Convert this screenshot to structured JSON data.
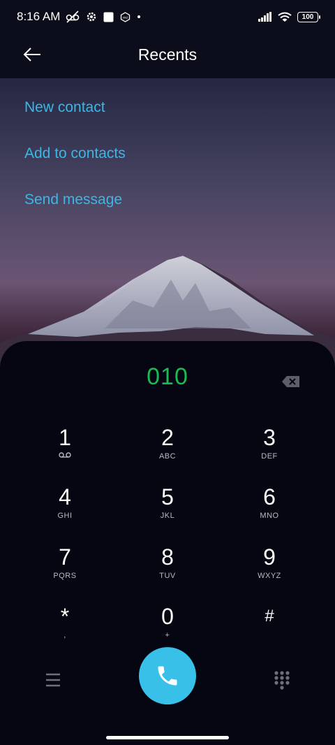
{
  "status_bar": {
    "time": "8:16 AM",
    "battery": "100",
    "icons": [
      "voicemail-muted-icon",
      "settings-icon",
      "square-icon",
      "mi-icon",
      "dot-icon",
      "signal-icon",
      "wifi-icon",
      "battery-icon"
    ]
  },
  "header": {
    "title": "Recents",
    "back_icon": "arrow-left-icon"
  },
  "actions": [
    {
      "label": "New contact"
    },
    {
      "label": "Add to contacts"
    },
    {
      "label": "Send message"
    }
  ],
  "dialer": {
    "number": "010",
    "backspace_icon": "backspace-icon",
    "keys": [
      {
        "digit": "1",
        "sub": ""
      },
      {
        "digit": "2",
        "sub": "ABC"
      },
      {
        "digit": "3",
        "sub": "DEF"
      },
      {
        "digit": "4",
        "sub": "GHI"
      },
      {
        "digit": "5",
        "sub": "JKL"
      },
      {
        "digit": "6",
        "sub": "MNO"
      },
      {
        "digit": "7",
        "sub": "PQRS"
      },
      {
        "digit": "8",
        "sub": "TUV"
      },
      {
        "digit": "9",
        "sub": "WXYZ"
      },
      {
        "digit": "*",
        "sub": ","
      },
      {
        "digit": "0",
        "sub": "+"
      },
      {
        "digit": "#",
        "sub": ""
      }
    ]
  },
  "bottom": {
    "menu_icon": "menu-icon",
    "call_icon": "phone-icon",
    "dialpad_icon": "dialpad-icon"
  },
  "colors": {
    "accent": "#3ab7e6",
    "number": "#1db954",
    "call": "#38c0e8"
  }
}
